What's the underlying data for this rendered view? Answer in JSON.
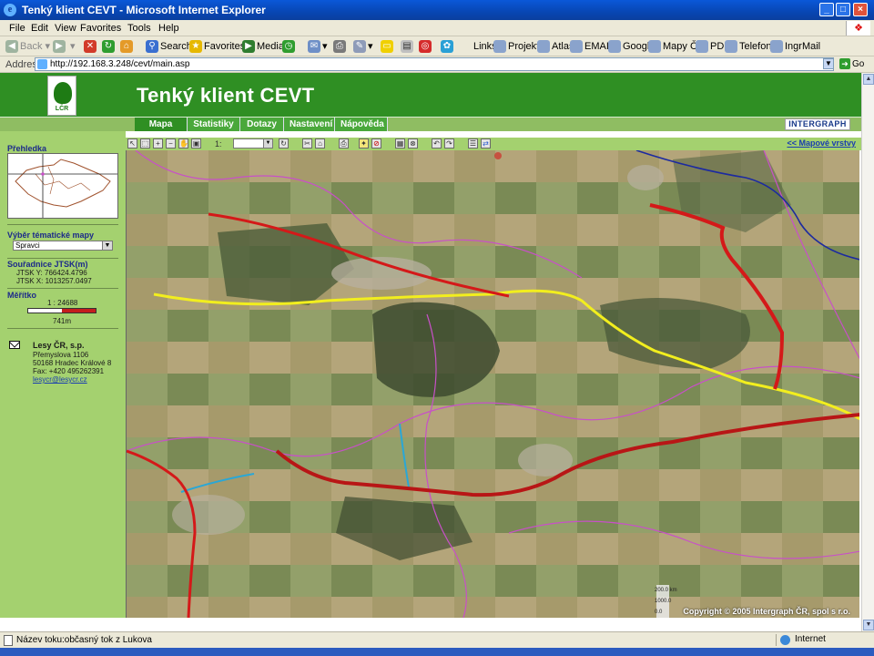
{
  "window": {
    "title": "Tenký klient CEVT - Microsoft Internet Explorer",
    "minimize": "_",
    "maximize": "□",
    "close": "×"
  },
  "menu": [
    "File",
    "Edit",
    "View",
    "Favorites",
    "Tools",
    "Help"
  ],
  "toolbar": {
    "back": "Back",
    "search": "Search",
    "favorites": "Favorites",
    "media": "Media",
    "links_label": "Links",
    "links": [
      "Projekty",
      "Atlas",
      "EMAIL",
      "Google",
      "Mapy ČR",
      "PDK",
      "Telefony",
      "IngrMail"
    ]
  },
  "address": {
    "label": "Address",
    "url": "http://192.168.3.248/cevt/main.asp",
    "go": "Go"
  },
  "app": {
    "title": "Tenký klient CEVT",
    "logo_text": "LČR",
    "brand": "INTERGRAPH",
    "tabs": [
      "Mapa",
      "Statistiky",
      "Dotazy",
      "Nastavení",
      "Nápověda"
    ],
    "active_tab": "Mapa"
  },
  "sidebar": {
    "overview_title": "Přehledka",
    "thematic_title": "Výběr tématické mapy",
    "thematic_value": "Spravci",
    "coords_title": "Souřadnice JTSK(m)",
    "jtsk_y_label": "JTSK Y:",
    "jtsk_y": "766424.4796",
    "jtsk_x_label": "JTSK X:",
    "jtsk_x": "1013257.0497",
    "scale_title": "Měřítko",
    "scale_value": "1 : 24688",
    "scale_bar_label": "741m",
    "contact": {
      "name": "Lesy ČR, s.p.",
      "street": "Přemyslova 1106",
      "city": "50168 Hradec Králové 8",
      "fax": "Fax: +420 495262391",
      "email": "lesycr@lesycr.cz"
    }
  },
  "maptools": {
    "scale_prefix": "1:",
    "layers_link": "<< Mapové vrstvy"
  },
  "map": {
    "copyright": "Copyright © 2005 Intergraph ČR, spol s r.o.",
    "legend_labels": [
      "200.0 km",
      "1000.0",
      "0.0"
    ]
  },
  "status": {
    "text": "Název toku:občasný tok z Lukova",
    "zone": "Internet"
  },
  "colors": {
    "banner": "#2f8f23",
    "sidebar": "#a4d16f",
    "river_red": "#d41919",
    "road_yellow": "#f2ee1e",
    "boundary_magenta": "#c850c8",
    "boundary_blue": "#1c2aa0",
    "stream_cyan": "#2aa7d6"
  }
}
